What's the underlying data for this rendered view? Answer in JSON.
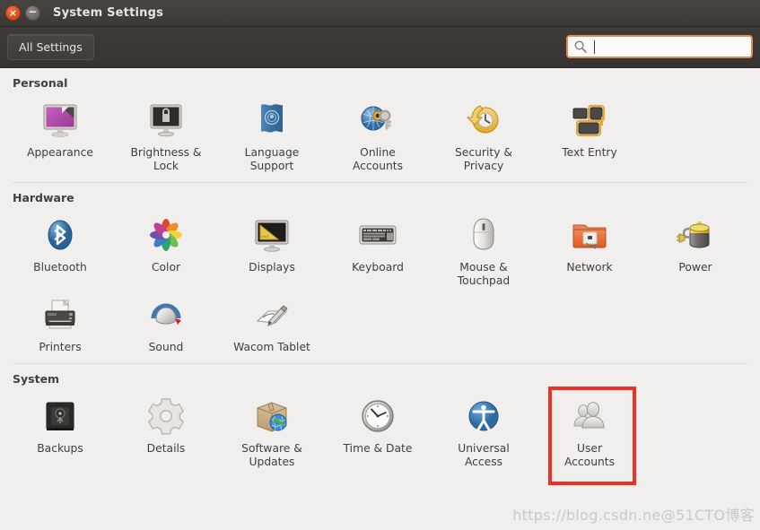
{
  "window": {
    "title": "System Settings",
    "close_icon": "close-icon",
    "close_glyph": "×",
    "minimize_icon": "minimize-icon",
    "minimize_glyph": "−"
  },
  "toolbar": {
    "all_settings_label": "All Settings",
    "search_icon": "search-icon",
    "search_value": "",
    "search_placeholder": "",
    "search_focus_color": "#e08b50"
  },
  "highlight": {
    "color": "#ef3124",
    "target": "User Accounts"
  },
  "watermark": "https://blog.csdn.ne@51CTO博客",
  "sections": [
    {
      "title": "Personal",
      "rows": [
        [
          {
            "label": "Appearance",
            "icon": "appearance-icon"
          },
          {
            "label": "Brightness &\nLock",
            "icon": "brightness-lock-icon"
          },
          {
            "label": "Language\nSupport",
            "icon": "language-support-icon"
          },
          {
            "label": "Online\nAccounts",
            "icon": "online-accounts-icon"
          },
          {
            "label": "Security &\nPrivacy",
            "icon": "security-privacy-icon"
          },
          {
            "label": "Text Entry",
            "icon": "text-entry-icon"
          }
        ]
      ]
    },
    {
      "title": "Hardware",
      "rows": [
        [
          {
            "label": "Bluetooth",
            "icon": "bluetooth-icon"
          },
          {
            "label": "Color",
            "icon": "color-icon"
          },
          {
            "label": "Displays",
            "icon": "displays-icon"
          },
          {
            "label": "Keyboard",
            "icon": "keyboard-icon"
          },
          {
            "label": "Mouse &\nTouchpad",
            "icon": "mouse-touchpad-icon"
          },
          {
            "label": "Network",
            "icon": "network-icon"
          },
          {
            "label": "Power",
            "icon": "power-icon"
          }
        ],
        [
          {
            "label": "Printers",
            "icon": "printers-icon"
          },
          {
            "label": "Sound",
            "icon": "sound-icon"
          },
          {
            "label": "Wacom Tablet",
            "icon": "wacom-tablet-icon"
          }
        ]
      ]
    },
    {
      "title": "System",
      "rows": [
        [
          {
            "label": "Backups",
            "icon": "backups-icon"
          },
          {
            "label": "Details",
            "icon": "details-icon"
          },
          {
            "label": "Software &\nUpdates",
            "icon": "software-updates-icon"
          },
          {
            "label": "Time & Date",
            "icon": "time-date-icon"
          },
          {
            "label": "Universal\nAccess",
            "icon": "universal-access-icon"
          },
          {
            "label": "User\nAccounts",
            "icon": "user-accounts-icon",
            "highlighted": true
          }
        ]
      ]
    }
  ]
}
